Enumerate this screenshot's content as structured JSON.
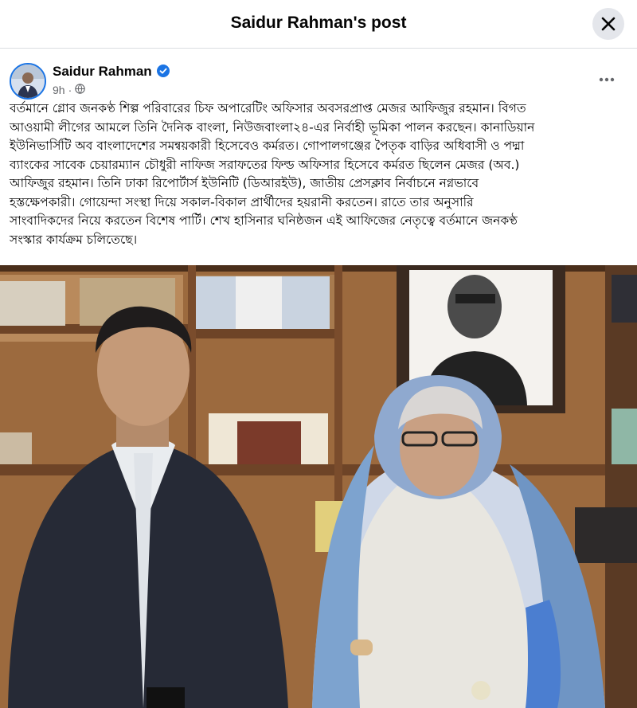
{
  "dialog": {
    "title": "Saidur Rahman's post",
    "close_icon": "close-icon"
  },
  "post": {
    "author": "Saidur Rahman",
    "verified": true,
    "time": "9h",
    "audience_icon": "globe-icon",
    "more_icon": "more-horizontal-icon",
    "text_lines": [
      "বর্তমানে গ্লোব জনকণ্ঠ শিল্প পরিবারের চিফ অপারেটিং অফিসার অবসরপ্রাপ্ত মেজর আফিজুর রহমান। বিগত",
      "আওয়ামী লীগের আমলে তিনি দৈনিক বাংলা, নিউজবাংলা২৪-এর নির্বাহী ভূমিকা পালন করছেন। কানাডিয়ান",
      "ইউনিভার্সিটি অব বাংলাদেশের সমন্বয়কারী হিসেবেও কর্মরত। গোপালগঞ্জের পৈতৃক বাড়ির অধিবাসী ও পদ্মা",
      "ব্যাংকের সাবেক চেয়ারম্যান চৌধুরী নাফিজ সরাফতের ফিল্ড অফিসার হিসেবে কর্মরত ছিলেন মেজর (অব.)",
      "আফিজুর রহমান। তিনি ঢাকা রিপোর্টার্স ইউনিটি (ডিআরইউ), জাতীয় প্রেসক্লাব নির্বাচনে নগ্নভাবে",
      "হস্তক্ষেপকারী। গোয়েন্দা সংস্থা দিয়ে সকাল-বিকাল প্রার্থীদের হয়রানী করতেন। রাতে তার অনুসারি",
      "সাংবাদিকদের নিয়ে করতেন বিশেষ পার্টি। শেখ হাসিনার ঘনিষ্ঠজন এই আফিজের নেতৃত্বে বর্তমানে জনকণ্ঠ",
      "সংস্কার কার্যক্রম চলিতেছে।"
    ]
  },
  "colors": {
    "accent_blue": "#1b74e4",
    "secondary_text": "#65676b",
    "divider": "#dadde1",
    "button_bg": "#e4e6eb"
  }
}
